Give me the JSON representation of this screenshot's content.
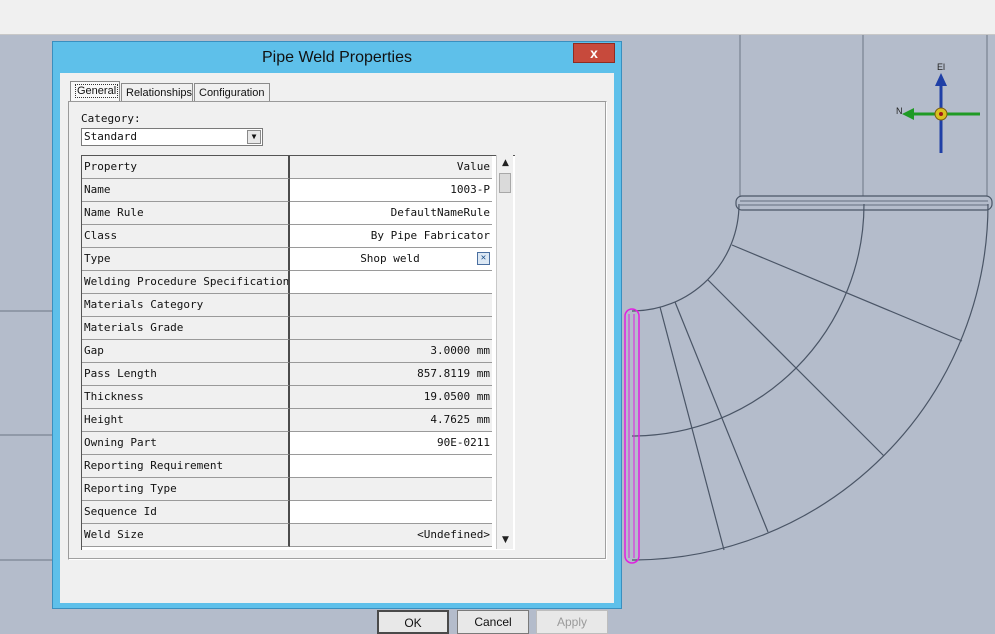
{
  "dialog": {
    "title": "Pipe Weld Properties",
    "close_label": "x",
    "tabs": [
      {
        "label": "General",
        "active": true
      },
      {
        "label": "Relationships",
        "active": false
      },
      {
        "label": "Configuration",
        "active": false
      }
    ],
    "category_label": "Category:",
    "category_value": "Standard",
    "grid_header": {
      "property": "Property",
      "value": "Value"
    },
    "rows": [
      {
        "name": "Name",
        "value": "1003-P"
      },
      {
        "name": "Name Rule",
        "value": "DefaultNameRule"
      },
      {
        "name": "Class",
        "value": "By Pipe Fabricator"
      },
      {
        "name": "Type",
        "value": "Shop weld"
      },
      {
        "name": "Welding Procedure Specification",
        "value": ""
      },
      {
        "name": "Materials Category",
        "value": ""
      },
      {
        "name": "Materials Grade",
        "value": ""
      },
      {
        "name": "Gap",
        "value": "3.0000 mm"
      },
      {
        "name": "Pass Length",
        "value": "857.8119 mm"
      },
      {
        "name": "Thickness",
        "value": "19.0500 mm"
      },
      {
        "name": "Height",
        "value": "4.7625 mm"
      },
      {
        "name": "Owning Part",
        "value": "90E-0211"
      },
      {
        "name": "Reporting Requirement",
        "value": ""
      },
      {
        "name": "Reporting Type",
        "value": ""
      },
      {
        "name": "Sequence Id",
        "value": ""
      },
      {
        "name": "Weld Size",
        "value": "<Undefined>"
      }
    ],
    "buttons": {
      "ok": "OK",
      "cancel": "Cancel",
      "apply": "Apply"
    }
  },
  "compass": {
    "up_label": "El",
    "left_label": "N"
  },
  "colors": {
    "title_bar": "#5ec0ea",
    "close_button": "#c74a3c",
    "weld_highlight": "#e020e0",
    "viewport": "#b4bccb"
  }
}
